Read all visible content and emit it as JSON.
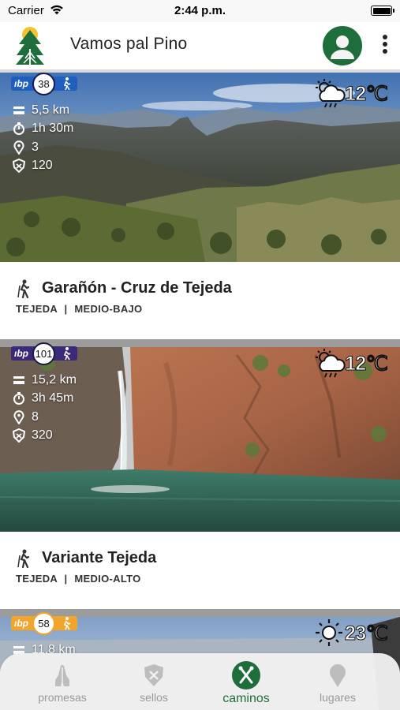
{
  "status_bar": {
    "carrier": "Carrier",
    "time": "2:44 p.m."
  },
  "header": {
    "title": "Vamos pal Pino"
  },
  "cards": [
    {
      "badge_logo": "ıbp",
      "badge_number": "38",
      "badge_color": "#1f5fbf",
      "distance": "5,5 km",
      "duration": "1h 30m",
      "points": "3",
      "elevation": "120",
      "weather_icon": "cloud-sun-rain-icon",
      "temperature": "12℃",
      "name": "Garañón - Cruz de Tejeda",
      "municipality": "TEJEDA",
      "difficulty": "MEDIO-BAJO"
    },
    {
      "badge_logo": "ıbp",
      "badge_number": "101",
      "badge_color": "#3b2a7a",
      "distance": "15,2 km",
      "duration": "3h 45m",
      "points": "8",
      "elevation": "320",
      "weather_icon": "cloud-sun-rain-icon",
      "temperature": "12℃",
      "name": "Variante Tejeda",
      "municipality": "TEJEDA",
      "difficulty": "MEDIO-ALTO"
    },
    {
      "badge_logo": "ıbp",
      "badge_number": "58",
      "badge_color": "#f2a52a",
      "distance": "11,8 km",
      "weather_icon": "sun-icon",
      "temperature": "23℃"
    }
  ],
  "separator": "|",
  "tabs": [
    {
      "label": "promesas",
      "icon": "praying-hands-icon"
    },
    {
      "label": "sellos",
      "icon": "shield-stamp-icon"
    },
    {
      "label": "caminos",
      "icon": "crossed-sticks-icon",
      "active": true
    },
    {
      "label": "lugares",
      "icon": "map-pin-icon"
    }
  ],
  "colors": {
    "brand_green": "#1e6e3c",
    "tab_inactive": "#999999"
  }
}
